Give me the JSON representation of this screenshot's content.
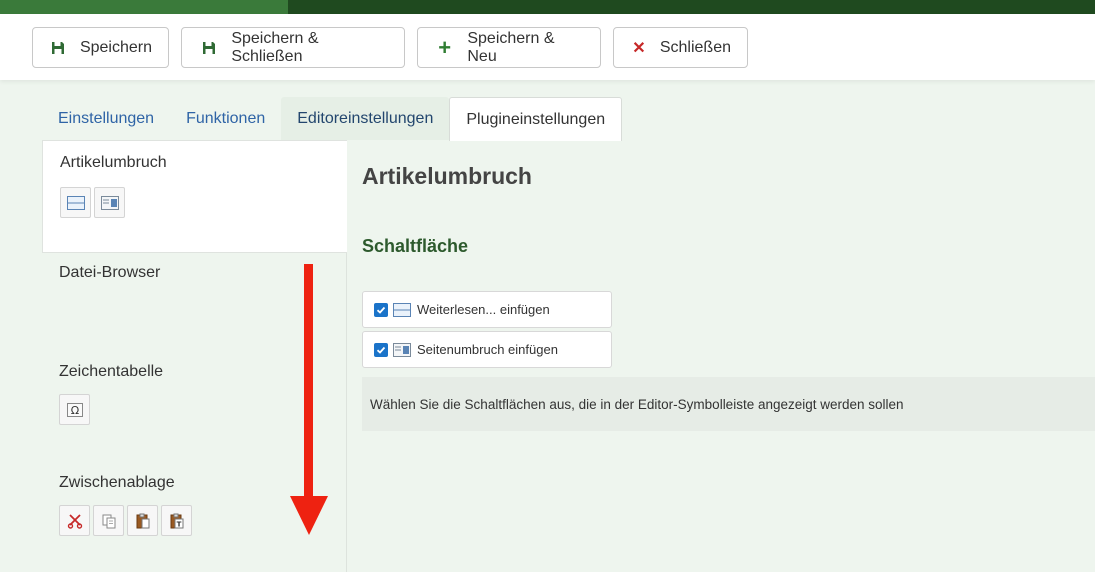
{
  "toolbar": {
    "save": "Speichern",
    "save_close": "Speichern & Schließen",
    "save_new": "Speichern & Neu",
    "close": "Schließen"
  },
  "tabs": [
    {
      "label": "Einstellungen"
    },
    {
      "label": "Funktionen"
    },
    {
      "label": "Editoreinstellungen"
    },
    {
      "label": "Plugineinstellungen"
    }
  ],
  "sidebar": {
    "items": [
      {
        "title": "Artikelumbruch",
        "icons": [
          "readmore-icon",
          "pagebreak-icon"
        ]
      },
      {
        "title": "Datei-Browser",
        "icons": []
      },
      {
        "title": "Zeichentabelle",
        "icons": [
          "omega-icon"
        ]
      },
      {
        "title": "Zwischenablage",
        "icons": [
          "cut-icon",
          "copy-icon",
          "paste-icon",
          "paste-text-icon"
        ]
      }
    ]
  },
  "content": {
    "title": "Artikelumbruch",
    "subtitle": "Schaltfläche",
    "options": [
      {
        "label": "Weiterlesen... einfügen",
        "checked": true,
        "icon": "readmore-icon"
      },
      {
        "label": "Seitenumbruch einfügen",
        "checked": true,
        "icon": "pagebreak-icon"
      }
    ],
    "help": "Wählen Sie die Schaltflächen aus, die in der Editor-Symbolleiste angezeigt werden sollen"
  },
  "colors": {
    "brand_dark": "#1f4a1f",
    "brand_accent": "#3a7a3a",
    "link": "#2f64a6",
    "checkbox": "#1a73c9",
    "arrow": "#ee2211"
  }
}
